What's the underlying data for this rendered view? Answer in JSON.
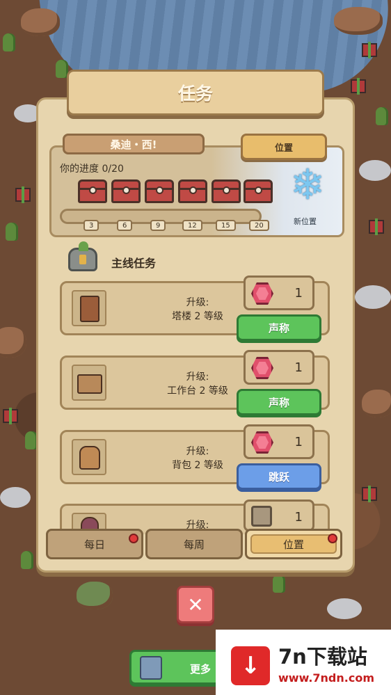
{
  "title": "任务",
  "event": {
    "name": "桑迪・西!",
    "location_button": "位置",
    "progress_label": "你的进度 0/20",
    "milestones": [
      "3",
      "6",
      "9",
      "12",
      "15",
      "20"
    ],
    "new_location_label": "新位置",
    "progress_value": 0,
    "progress_max": 20
  },
  "section": {
    "title": "主线任务"
  },
  "quests": [
    {
      "line1": "升级:",
      "line2": "塔楼 2 等级",
      "reward_count": "1",
      "reward_icon": "gem-icon",
      "button": "声称",
      "button_color": "green"
    },
    {
      "line1": "升级:",
      "line2": "工作台 2 等级",
      "reward_count": "1",
      "reward_icon": "gem-icon",
      "button": "声称",
      "button_color": "green"
    },
    {
      "line1": "升级:",
      "line2": "背包 2 等级",
      "reward_count": "1",
      "reward_icon": "gem-icon",
      "button": "跳跃",
      "button_color": "blue"
    },
    {
      "line1": "升级:",
      "line2": "",
      "reward_count": "1",
      "reward_icon": "crate-icon",
      "button": "",
      "button_color": ""
    }
  ],
  "tabs": [
    {
      "label": "每日",
      "badge": true
    },
    {
      "label": "每周",
      "badge": false
    },
    {
      "label": "位置",
      "badge": true,
      "active": true
    }
  ],
  "close_icon": "close-icon",
  "more_button": {
    "label": "更多"
  },
  "watermark": {
    "logo": "↓",
    "title": "7n下载站",
    "url": "www.7ndn.com"
  },
  "colors": {
    "claim_green": "#5dc45b",
    "jump_blue": "#6c9ee8",
    "badge_red": "#e03b3b",
    "gem_pink": "#e04f6b"
  }
}
